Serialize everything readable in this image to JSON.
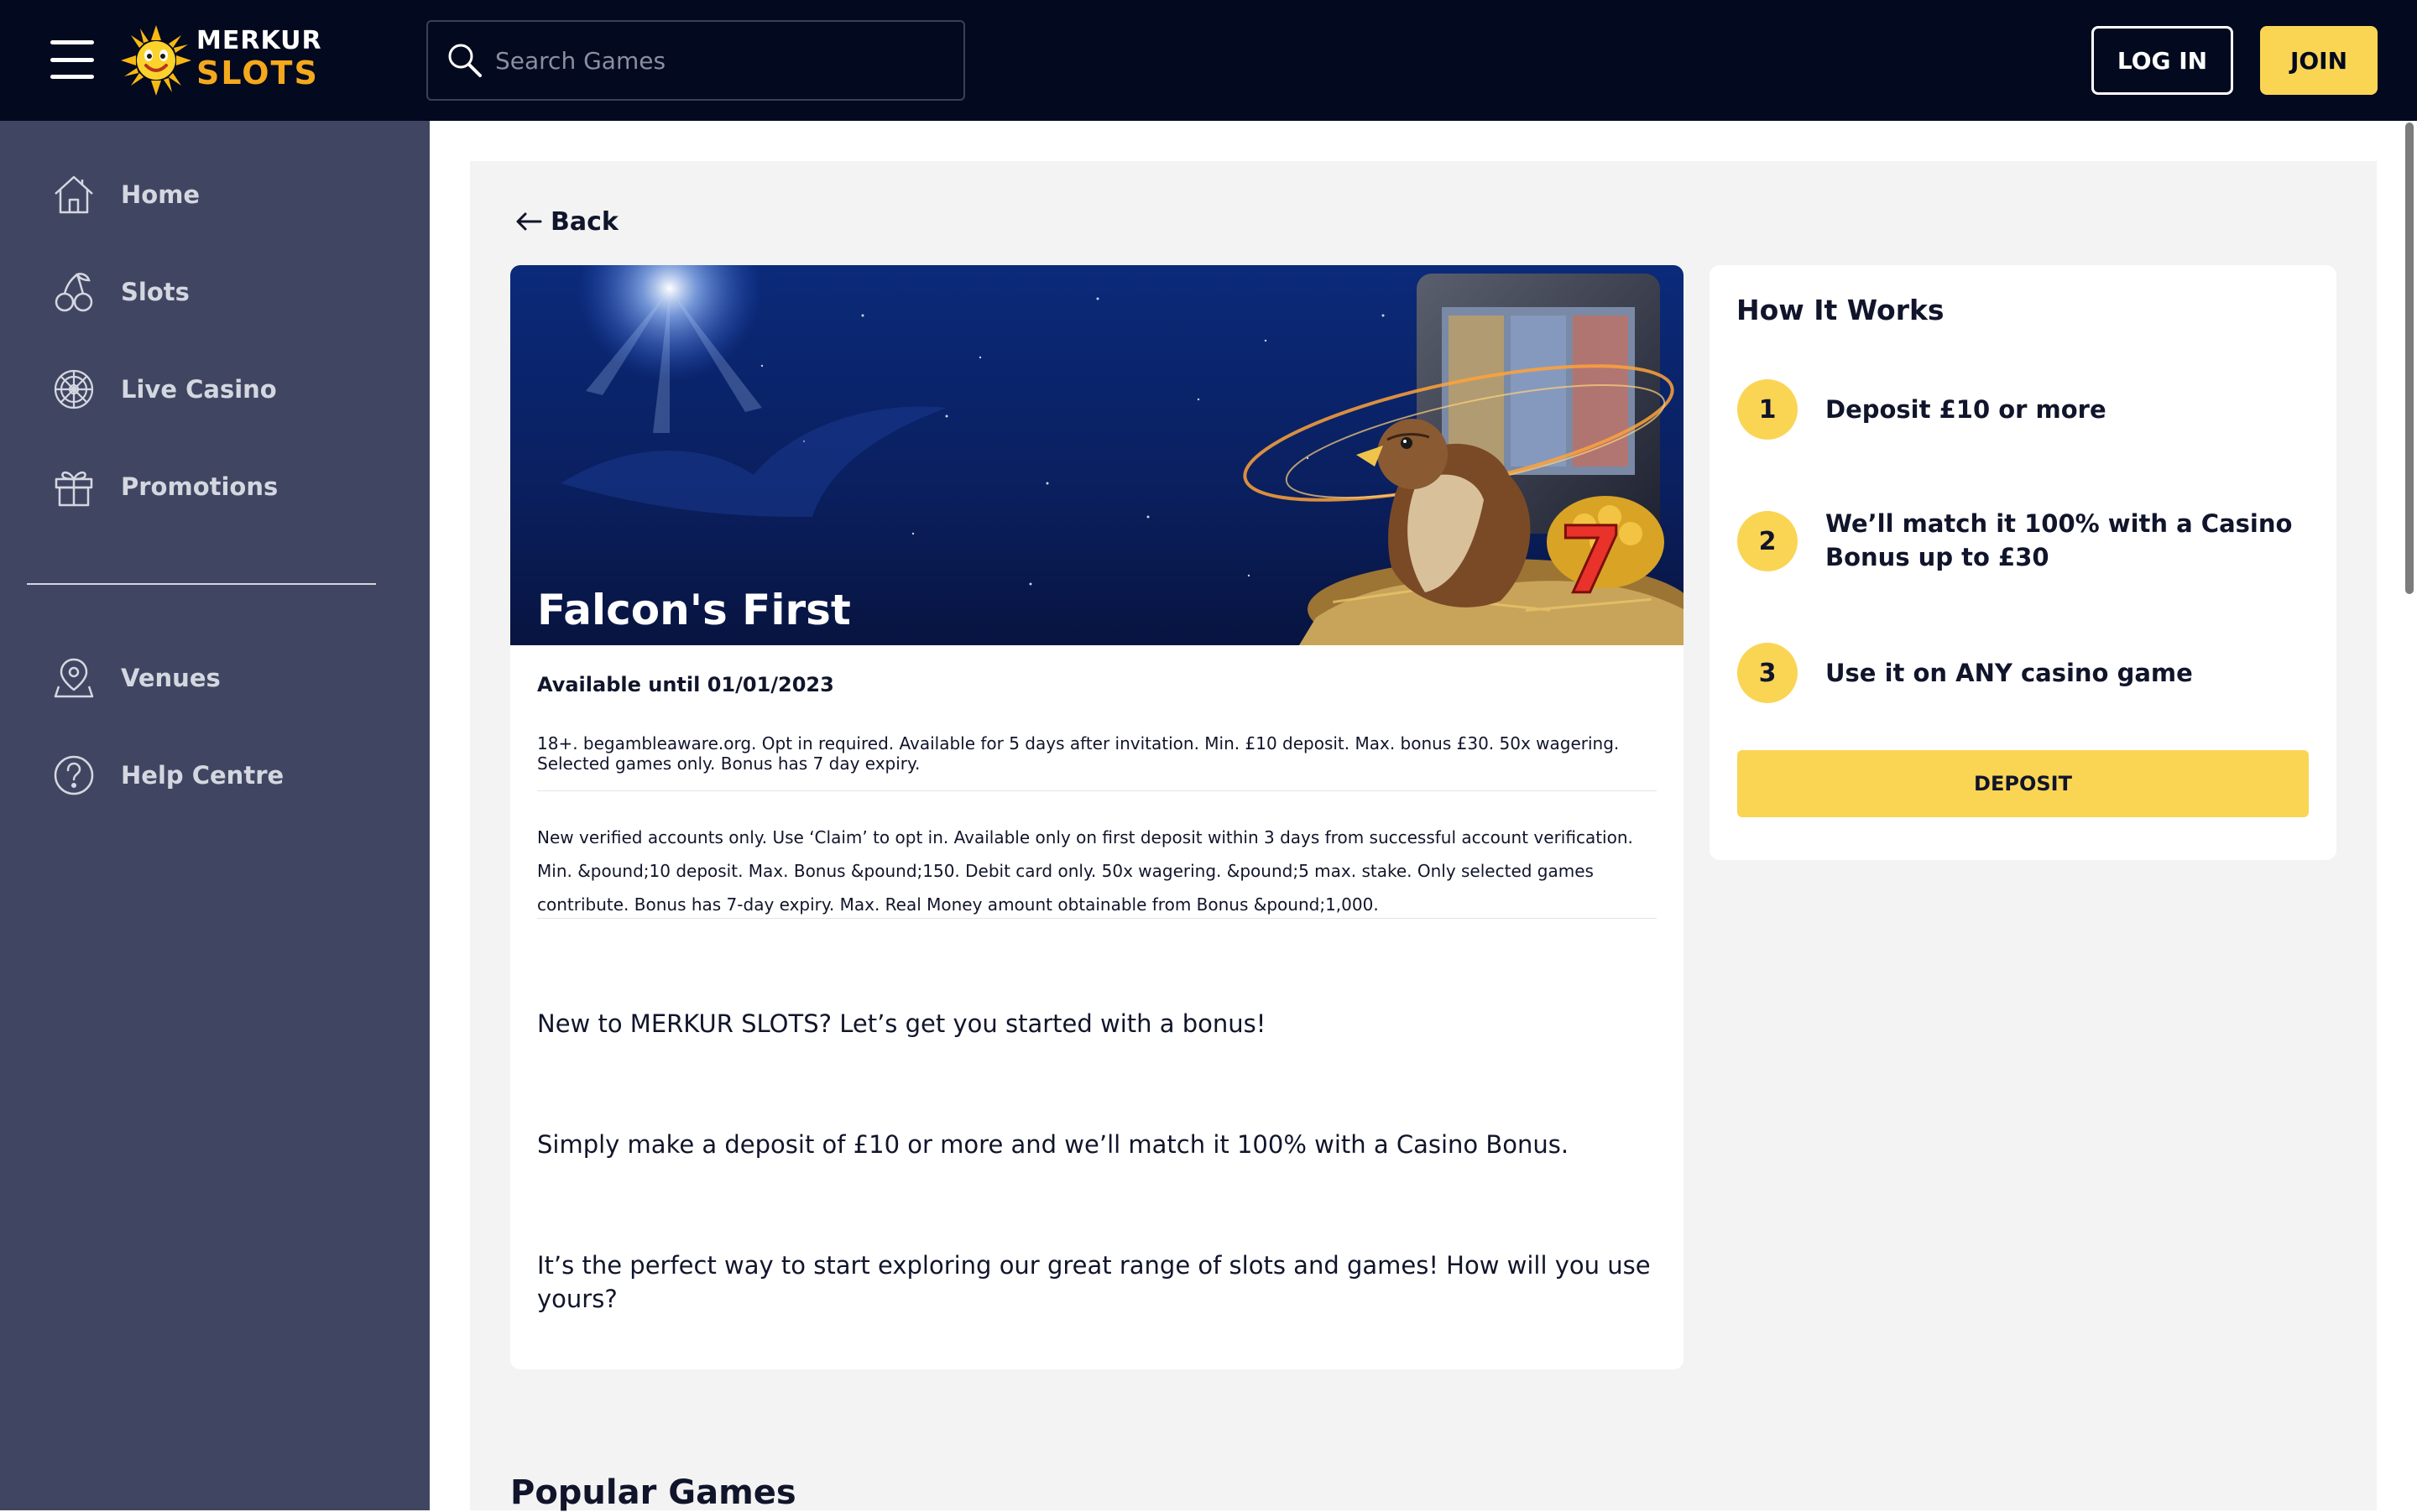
{
  "colors": {
    "header_bg": "#03091f",
    "sidebar_bg": "#404662",
    "accent_yellow": "#fad554",
    "logo_orange": "#f4a81d",
    "content_bg": "#f3f3f3"
  },
  "header": {
    "logo": {
      "line1": "MERKUR",
      "line2": "SLOTS",
      "mascot_icon": "sun-mascot-icon"
    },
    "menu_icon": "hamburger-icon",
    "search": {
      "placeholder": "Search Games",
      "value": "",
      "icon": "search-icon"
    },
    "login_label": "LOG IN",
    "join_label": "JOIN"
  },
  "sidebar": {
    "items": [
      {
        "label": "Home",
        "icon": "home-icon"
      },
      {
        "label": "Slots",
        "icon": "cherries-icon"
      },
      {
        "label": "Live Casino",
        "icon": "roulette-icon"
      },
      {
        "label": "Promotions",
        "icon": "gift-icon"
      },
      {
        "label": "Venues",
        "icon": "location-pin-icon"
      },
      {
        "label": "Help Centre",
        "icon": "question-circle-icon"
      }
    ]
  },
  "main": {
    "back_label": "Back",
    "promo": {
      "title": "Falcon's First",
      "banner": "falcon-slot-machine-banner",
      "available": "Available until 01/01/2023",
      "terms_short": "18+. begambleaware.org. Opt in required. Available for 5 days after invitation. Min. £10 deposit. Max. bonus £30. 50x wagering. Selected games only. Bonus has 7 day expiry.",
      "terms_long": "New verified accounts only. Use ‘Claim’ to opt in. Available only on first deposit within 3 days from successful account verification. Min. &pound;10 deposit. Max. Bonus &pound;150. Debit card only. 50x wagering. &pound;5 max. stake. Only selected games contribute. Bonus has 7-day expiry. Max. Real Money amount obtainable from Bonus &pound;1,000.",
      "paragraphs": [
        "New to MERKUR SLOTS? Let’s get you started with a bonus!",
        "Simply make a deposit of £10 or more and we’ll match it 100% with a Casino Bonus.",
        "It’s the perfect way to start exploring our great range of slots and games! How will you use yours?"
      ]
    },
    "how_it_works": {
      "title": "How It Works",
      "steps": [
        {
          "number": "1",
          "text": "Deposit £10 or more"
        },
        {
          "number": "2",
          "text": "We’ll match it 100% with a Casino Bonus up to £30"
        },
        {
          "number": "3",
          "text": "Use it on ANY casino game"
        }
      ],
      "deposit_label": "DEPOSIT"
    },
    "popular_heading": "Popular Games"
  }
}
